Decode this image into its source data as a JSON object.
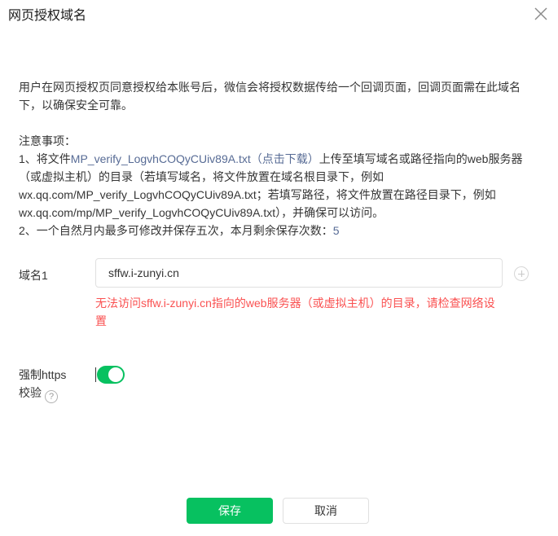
{
  "dialog": {
    "title": "网页授权域名",
    "close_icon": "close-icon"
  },
  "description": "用户在网页授权页同意授权给本账号后，微信会将授权数据传给一个回调页面，回调页面需在此域名下，以确保安全可靠。",
  "notes": {
    "heading": "注意事项：",
    "item1_prefix": "1、将文件",
    "item1_link": "MP_verify_LogvhCOQyCUiv89A.txt（点击下载）",
    "item1_suffix": "上传至填写域名或路径指向的web服务器",
    "item1_line2": "（或虚拟主机）的目录（若填写域名，将文件放置在域名根目录下，例如",
    "item1_line3": "wx.qq.com/MP_verify_LogvhCOQyCUiv89A.txt；若填写路径，将文件放置在路径目录下，例如",
    "item1_line4": "wx.qq.com/mp/MP_verify_LogvhCOQyCUiv89A.txt），并确保可以访问。",
    "item2_text": "2、一个自然月内最多可修改并保存五次，本月剩余保存次数：",
    "item2_count": "5"
  },
  "domain_field": {
    "label": "域名1",
    "value": "sffw.i-zunyi.cn",
    "add_icon": "plus-circle-icon",
    "error": "无法访问sffw.i-zunyi.cn指向的web服务器（或虚拟主机）的目录，请检查网络设置"
  },
  "https": {
    "label_line1": "强制https",
    "label_line2": "校验",
    "help_icon": "question-circle-icon",
    "help_glyph": "?",
    "enabled": true,
    "on_color": "#07c160"
  },
  "footer": {
    "save_label": "保存",
    "cancel_label": "取消",
    "primary_color": "#07c160"
  }
}
